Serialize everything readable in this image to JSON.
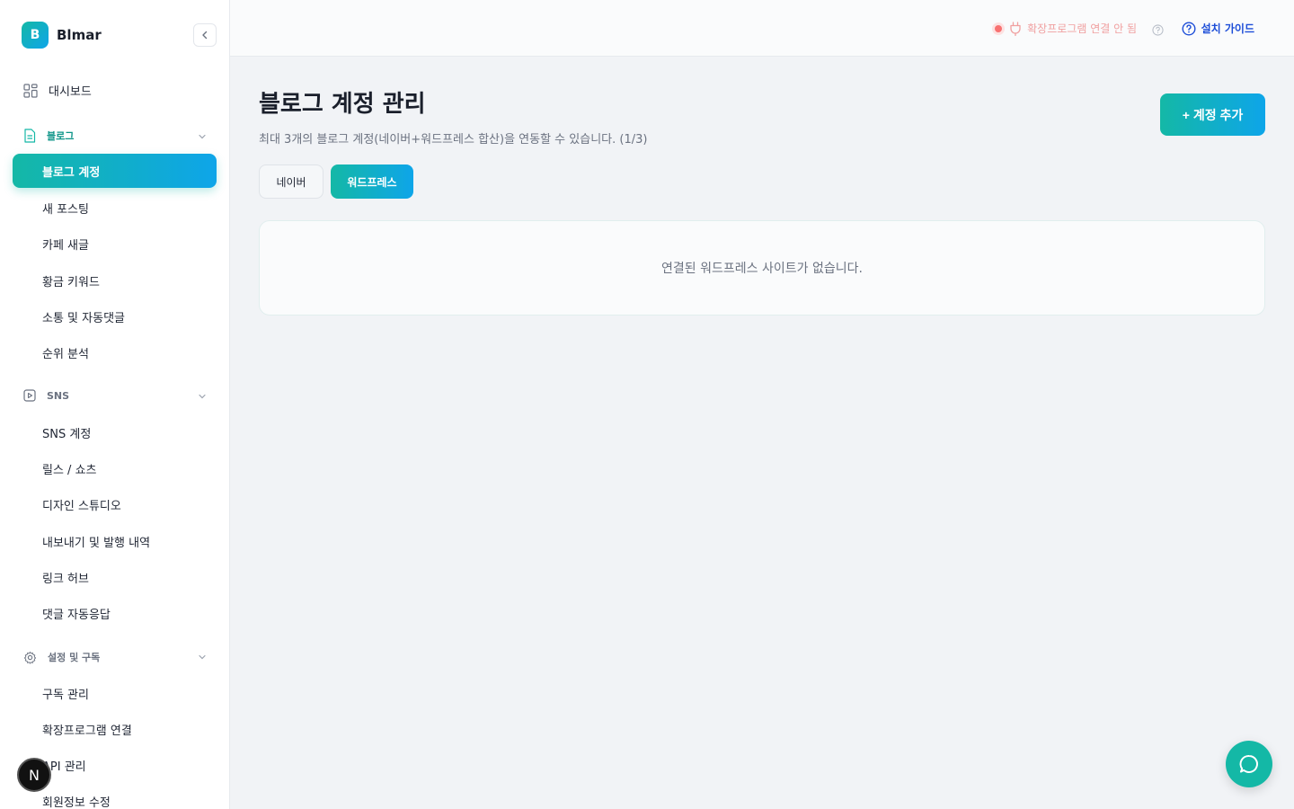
{
  "brand": {
    "initial": "B",
    "name": "Blmar"
  },
  "sidebar": {
    "dashboard": "대시보드",
    "blog_section": "블로그",
    "blog_items": [
      "블로그 계정",
      "새 포스팅",
      "카페 새글",
      "황금 키워드",
      "소통 및 자동댓글",
      "순위 분석"
    ],
    "sns_section": "SNS",
    "sns_items": [
      "SNS 계정",
      "릴스 / 쇼츠",
      "디자인 스튜디오",
      "내보내기 및 발행 내역",
      "링크 허브",
      "댓글 자동응답"
    ],
    "settings_section": "설정 및 구독",
    "settings_items": [
      "구독 관리",
      "확장프로그램 연결",
      "API 관리",
      "회원정보 수정"
    ],
    "n_badge": "N"
  },
  "topbar": {
    "extension_status": "확장프로그램 연결 안 됨",
    "install_guide": "설치 가이드"
  },
  "main": {
    "title": "블로그 계정 관리",
    "description": "최대 3개의 블로그 계정(네이버+워드프레스 합산)을 연동할 수 있습니다. (1/3)",
    "add_button": "+ 계정 추가",
    "tabs": [
      "네이버",
      "워드프레스"
    ],
    "active_tab": "워드프레스",
    "empty_message": "연결된 워드프레스 사이트가 없습니다."
  },
  "colors": {
    "accent_start": "#14b8a6",
    "accent_end": "#0ea5e9",
    "status_error": "#f87171",
    "link": "#1d4ed8"
  }
}
